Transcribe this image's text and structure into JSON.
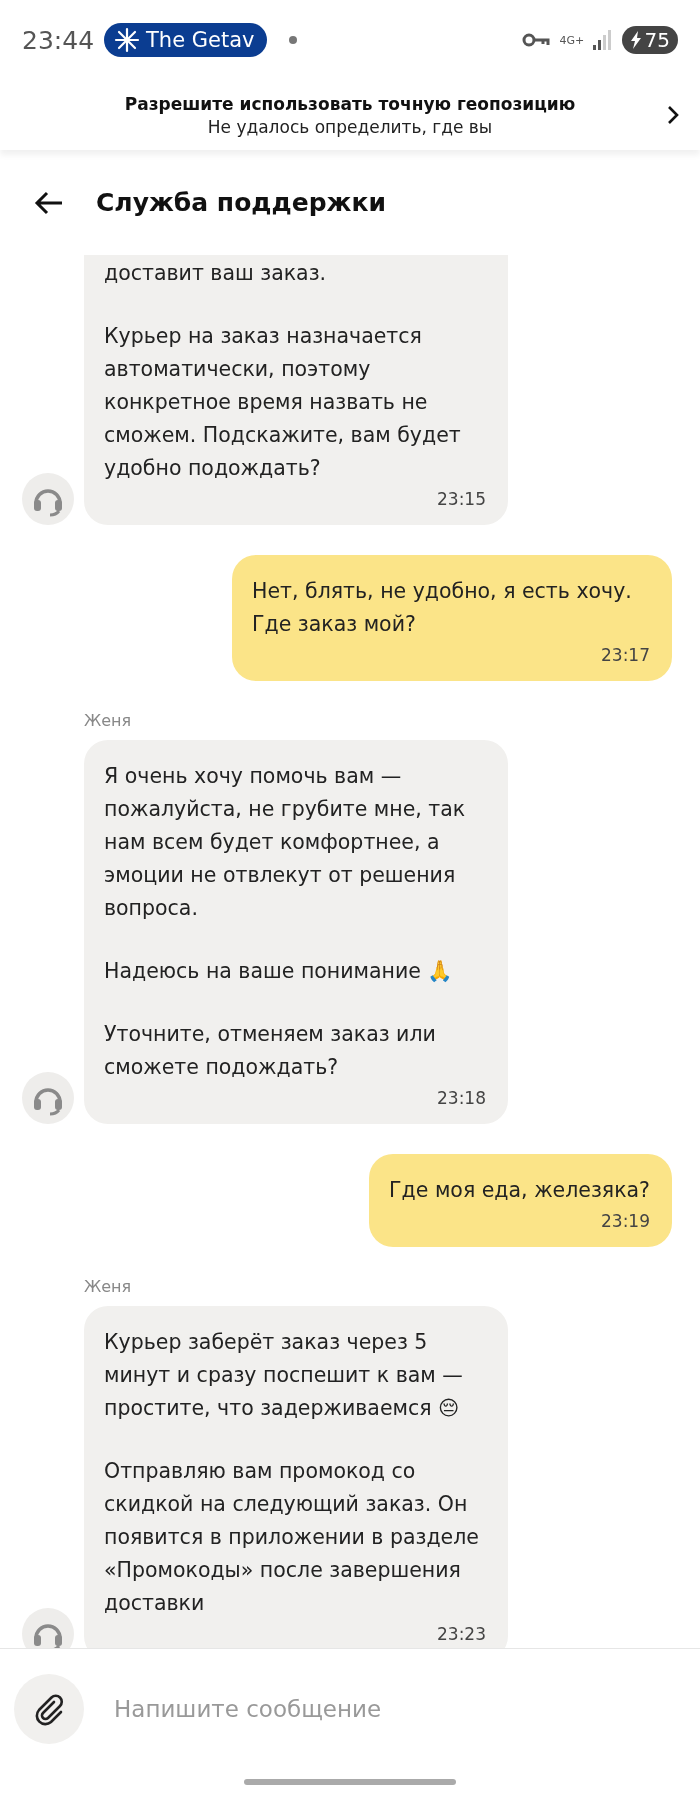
{
  "status_bar": {
    "time": "23:44",
    "notification": "The Getav",
    "network": "4G+",
    "battery": "75"
  },
  "location_banner": {
    "title": "Разрешите использовать точную геопозицию",
    "subtitle": "Не удалось определить, где вы"
  },
  "header": {
    "title": "Служба поддержки"
  },
  "messages": [
    {
      "kind": "agent",
      "clipped": true,
      "paragraphs": [
        {
          "text": "доставит ваш заказ."
        },
        {
          "text": "Курьер на заказ назначается автоматически, поэтому конкретное время назвать не сможем. Подскажите, вам будет удобно подождать?"
        }
      ],
      "time": "23:15"
    },
    {
      "kind": "user",
      "paragraphs": [
        {
          "text": "Нет, блять, не удобно, я есть хочу. Где заказ мой?"
        }
      ],
      "time": "23:17"
    },
    {
      "kind": "agent",
      "sender": "Женя",
      "paragraphs": [
        {
          "text": "Я очень хочу помочь вам — пожалуйста, не грубите мне, так нам всем будет комфортнее, а эмоции не отвлекут от решения вопроса."
        },
        {
          "text": "Надеюсь на ваше понимание 🙏"
        },
        {
          "text": "Уточните, отменяем заказ или сможете подождать?"
        }
      ],
      "time": "23:18"
    },
    {
      "kind": "user",
      "paragraphs": [
        {
          "text": "Где моя еда, железяка?"
        }
      ],
      "time": "23:19"
    },
    {
      "kind": "agent",
      "sender": "Женя",
      "paragraphs": [
        {
          "text": "Курьер заберёт заказ через 5 минут и сразу поспешит к вам — простите, что задерживаемся 😔"
        },
        {
          "text": "Отправляю вам промокод со скидкой на следующий заказ. Он появится в приложении в разделе «Промокоды» после завершения доставки"
        }
      ],
      "time": "23:23"
    }
  ],
  "composer": {
    "placeholder": "Напишите сообщение"
  }
}
